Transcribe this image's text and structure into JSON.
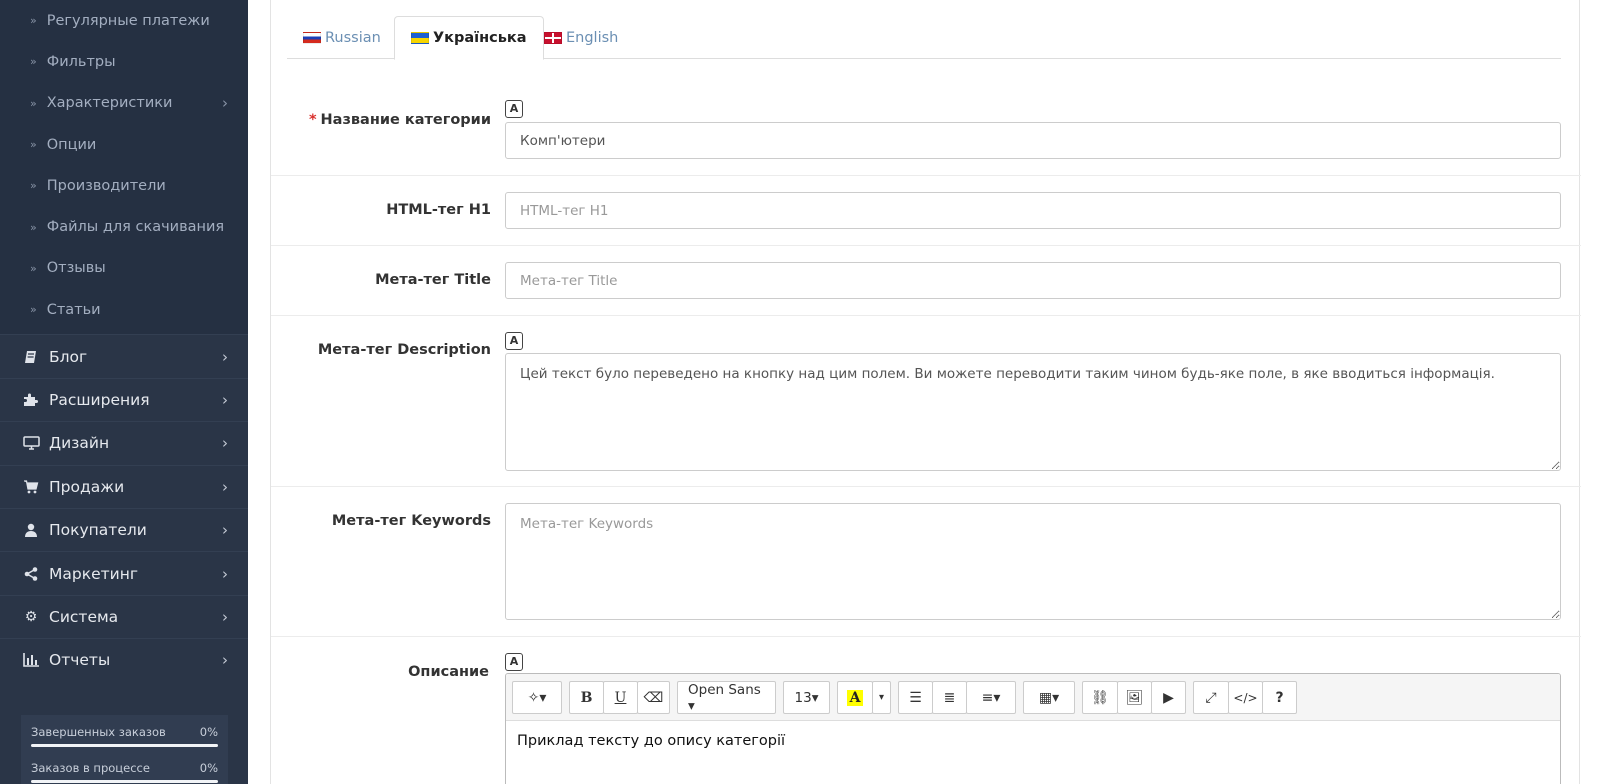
{
  "sidebar": {
    "sub_items": [
      {
        "label": "Регулярные платежи",
        "has_children": false
      },
      {
        "label": "Фильтры",
        "has_children": false
      },
      {
        "label": "Характеристики",
        "has_children": true
      },
      {
        "label": "Опции",
        "has_children": false
      },
      {
        "label": "Производители",
        "has_children": false
      },
      {
        "label": "Файлы для скачивания",
        "has_children": false
      },
      {
        "label": "Отзывы",
        "has_children": false
      },
      {
        "label": "Статьи",
        "has_children": false
      }
    ],
    "main_items": [
      {
        "label": "Блог",
        "icon": "book-icon"
      },
      {
        "label": "Расширения",
        "icon": "puzzle-icon"
      },
      {
        "label": "Дизайн",
        "icon": "monitor-icon"
      },
      {
        "label": "Продажи",
        "icon": "cart-icon"
      },
      {
        "label": "Покупатели",
        "icon": "user-icon"
      },
      {
        "label": "Маркетинг",
        "icon": "share-icon"
      },
      {
        "label": "Система",
        "icon": "gear-icon"
      },
      {
        "label": "Отчеты",
        "icon": "bar-chart-icon"
      }
    ],
    "progress": [
      {
        "label": "Завершенных заказов",
        "value": "0%"
      },
      {
        "label": "Заказов в процессе",
        "value": "0%"
      }
    ]
  },
  "tabs": [
    {
      "label": "Russian",
      "flag": "ru"
    },
    {
      "label": "Українська",
      "flag": "ua",
      "active": true
    },
    {
      "label": "English",
      "flag": "en"
    }
  ],
  "form": {
    "category_name": {
      "label": "Название категории",
      "value": "Комп'ютери",
      "required": true
    },
    "h1": {
      "label": "HTML-тег H1",
      "placeholder": "HTML-тег H1",
      "value": ""
    },
    "meta_title": {
      "label": "Мета-тег Title",
      "placeholder": "Мета-тег Title",
      "value": ""
    },
    "meta_description": {
      "label": "Мета-тег Description",
      "value": "Цей текст було переведено на кнопку над цим полем. Ви можете переводити таким чином будь-яке поле, в яке вводиться інформація."
    },
    "meta_keywords": {
      "label": "Мета-тег Keywords",
      "placeholder": "Мета-тег Keywords",
      "value": ""
    },
    "description": {
      "label": "Описание",
      "content": "Приклад тексту до опису категорії"
    }
  },
  "editor_toolbar": {
    "font_name": "Open Sans ▾",
    "font_size": "13▾"
  },
  "colors": {
    "sidebar_bg": "#2a3547",
    "required": "#d9302c",
    "link": "#6b8fb3"
  }
}
